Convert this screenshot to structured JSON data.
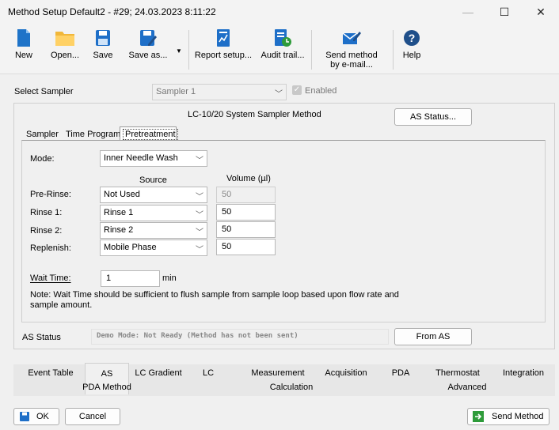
{
  "window": {
    "title": "Method Setup Default2 - #29;  24.03.2023  8:11:22",
    "minimize": "—",
    "maximize": "☐",
    "close": "✕"
  },
  "toolbar": {
    "new": "New",
    "open": "Open...",
    "save": "Save",
    "save_as": "Save as...",
    "report_setup": "Report setup...",
    "audit_trail": "Audit trail...",
    "send_method": "Send method by e-mail...",
    "help": "Help"
  },
  "sampler_select": {
    "label": "Select Sampler",
    "value": "Sampler 1",
    "enabled_label": "Enabled"
  },
  "method_panel": {
    "title": "LC-10/20 System Sampler Method",
    "as_status_button": "AS Status...",
    "tabs": [
      "Sampler",
      "Time Program",
      "Pretreatment"
    ],
    "active_tab": "Pretreatment"
  },
  "pretreatment": {
    "mode_label": "Mode:",
    "mode_value": "Inner Needle Wash",
    "source_header": "Source",
    "volume_header": "Volume (µl)",
    "rows": [
      {
        "label": "Pre-Rinse:",
        "source": "Not Used",
        "volume": "50",
        "disabled": true
      },
      {
        "label": "Rinse 1:",
        "source": "Rinse 1",
        "volume": "50",
        "disabled": false
      },
      {
        "label": "Rinse 2:",
        "source": "Rinse 2",
        "volume": "50",
        "disabled": false
      },
      {
        "label": "Replenish:",
        "source": "Mobile Phase",
        "volume": "50",
        "disabled": false
      }
    ],
    "wait_label": "Wait Time:",
    "wait_value": "1",
    "wait_unit": "min",
    "note_line1": "Note: Wait Time should be sufficient to flush sample from sample loop based upon flow rate and",
    "note_line2": "sample amount."
  },
  "as_status": {
    "label": "AS Status",
    "value": "Demo Mode: Not Ready (Method has not been sent)",
    "from_as": "From AS"
  },
  "bottom_tabs": {
    "row1": [
      "Event Table",
      "AS",
      "LC Gradient",
      "LC",
      "Measurement",
      "Acquisition",
      "PDA",
      "Thermostat",
      "Integration"
    ],
    "row2": [
      "PDA Method",
      "Calculation",
      "Advanced"
    ]
  },
  "footer": {
    "ok": "OK",
    "cancel": "Cancel",
    "send_method": "Send Method"
  },
  "colors": {
    "accent": "#1e6fc8",
    "green": "#2e9b3a"
  }
}
